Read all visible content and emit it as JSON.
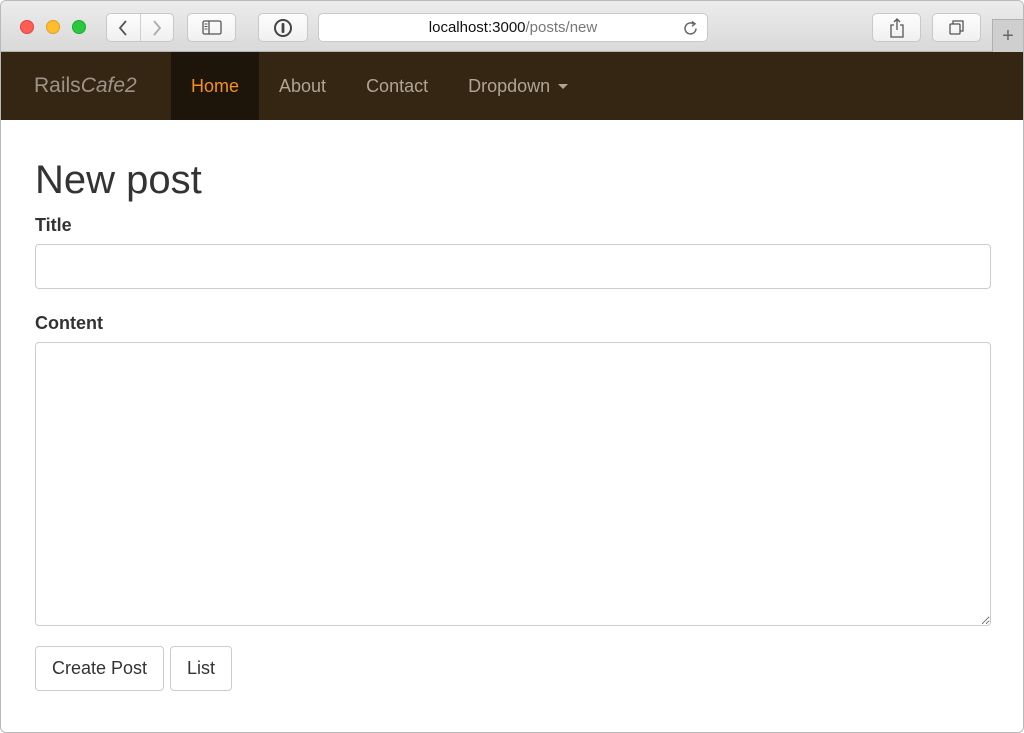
{
  "browser": {
    "url_host": "localhost:3000",
    "url_path": "/posts/new",
    "new_tab_label": "+",
    "icons": [
      "back-icon",
      "forward-icon",
      "sidebar-icon",
      "onepassword-icon",
      "reload-icon",
      "share-icon",
      "tabs-icon",
      "plus-icon"
    ]
  },
  "navbar": {
    "brand_plain": "Rails",
    "brand_italic": "Cafe2",
    "items": [
      {
        "label": "Home"
      },
      {
        "label": "About"
      },
      {
        "label": "Contact"
      },
      {
        "label": "Dropdown"
      }
    ],
    "colors": {
      "background": "#352613",
      "active_bg": "#1e150a",
      "active_text": "#f3911f",
      "text": "#aea593"
    }
  },
  "form": {
    "heading": "New post",
    "title_label": "Title",
    "title_value": "",
    "content_label": "Content",
    "content_value": "",
    "submit_label": "Create Post",
    "list_label": "List"
  }
}
